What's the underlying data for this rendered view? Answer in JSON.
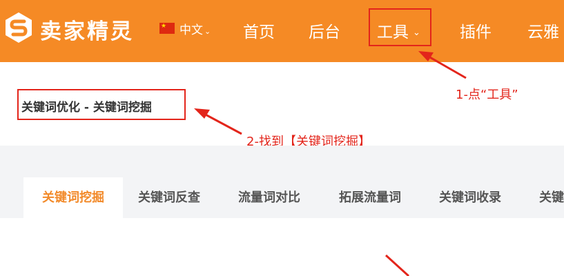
{
  "header": {
    "brand": "卖家精灵",
    "language": "中文",
    "nav": [
      "首页",
      "后台",
      "工具",
      "插件",
      "云雅"
    ]
  },
  "breadcrumb": "关键词优化 - 关键词挖掘",
  "annotations": {
    "step1": "1-点“工具”",
    "step2": "2-找到【关键词挖掘】"
  },
  "tabs": [
    "关键词挖掘",
    "关键词反查",
    "流量词对比",
    "拓展流量词",
    "关键词收录",
    "关键"
  ],
  "colors": {
    "header_bg": "#f58a25",
    "active_tab": "#f28a2a",
    "annotation": "#e3251b"
  },
  "icons": {
    "logo": "brand-logo-icon",
    "flag": "china-flag-icon",
    "caret": "chevron-down-icon"
  }
}
